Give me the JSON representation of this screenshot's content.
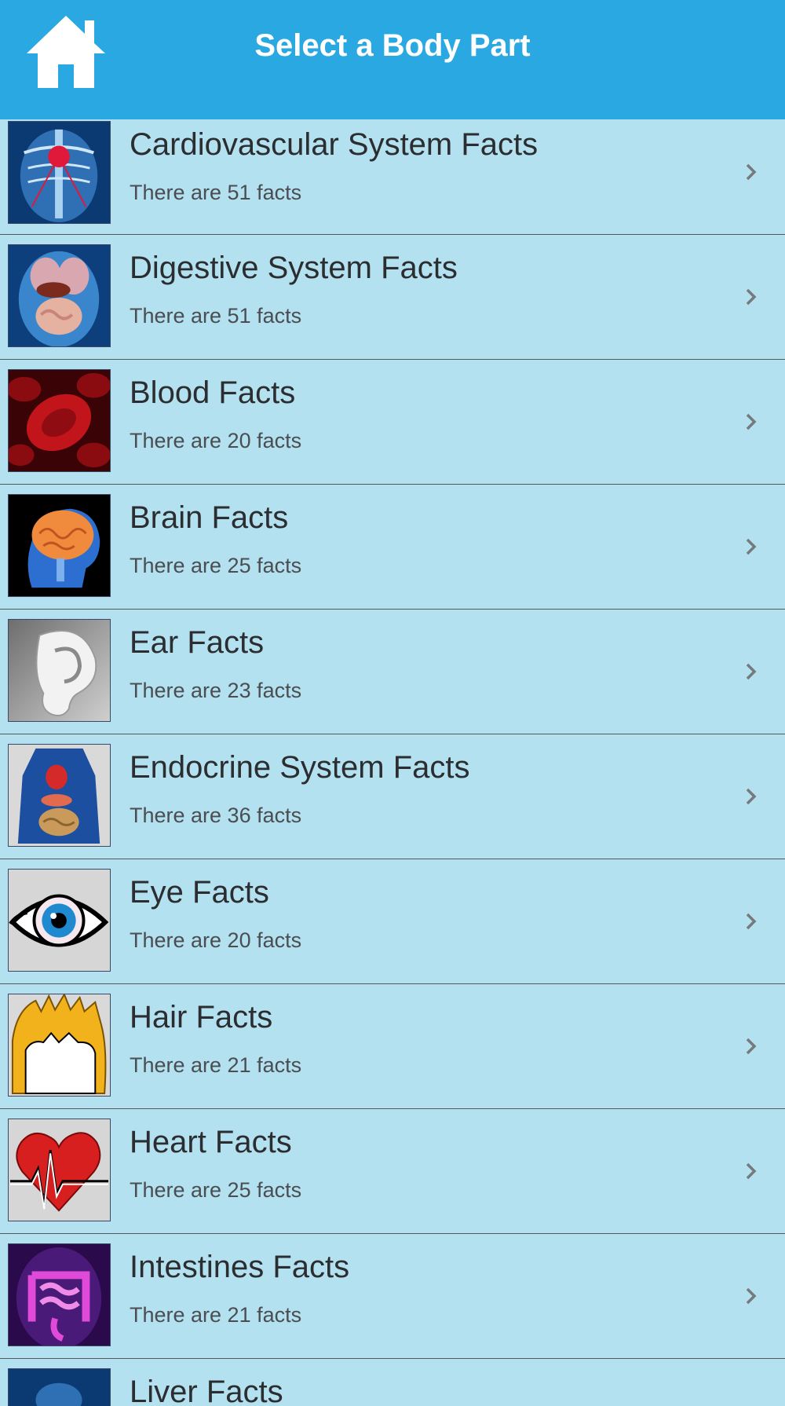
{
  "header": {
    "title": "Select a Body Part",
    "home_icon": "home-icon",
    "background": "#29a8e1"
  },
  "list": {
    "background": "#b3e1ef",
    "items": [
      {
        "title": "Cardiovascular System Facts",
        "subtitle": "There are 51 facts",
        "icon": "cardiovascular-icon"
      },
      {
        "title": "Digestive System Facts",
        "subtitle": "There are 51 facts",
        "icon": "digestive-icon"
      },
      {
        "title": "Blood Facts",
        "subtitle": "There are 20 facts",
        "icon": "blood-icon"
      },
      {
        "title": "Brain Facts",
        "subtitle": "There are 25 facts",
        "icon": "brain-icon"
      },
      {
        "title": "Ear Facts",
        "subtitle": "There are 23 facts",
        "icon": "ear-icon"
      },
      {
        "title": "Endocrine System Facts",
        "subtitle": "There are 36 facts",
        "icon": "endocrine-icon"
      },
      {
        "title": "Eye Facts",
        "subtitle": "There are 20 facts",
        "icon": "eye-icon"
      },
      {
        "title": "Hair Facts",
        "subtitle": "There are 21 facts",
        "icon": "hair-icon"
      },
      {
        "title": "Heart Facts",
        "subtitle": "There are 25 facts",
        "icon": "heart-icon"
      },
      {
        "title": "Intestines Facts",
        "subtitle": "There are 21 facts",
        "icon": "intestines-icon"
      },
      {
        "title": "Liver Facts",
        "subtitle": "",
        "icon": "liver-icon"
      }
    ]
  }
}
